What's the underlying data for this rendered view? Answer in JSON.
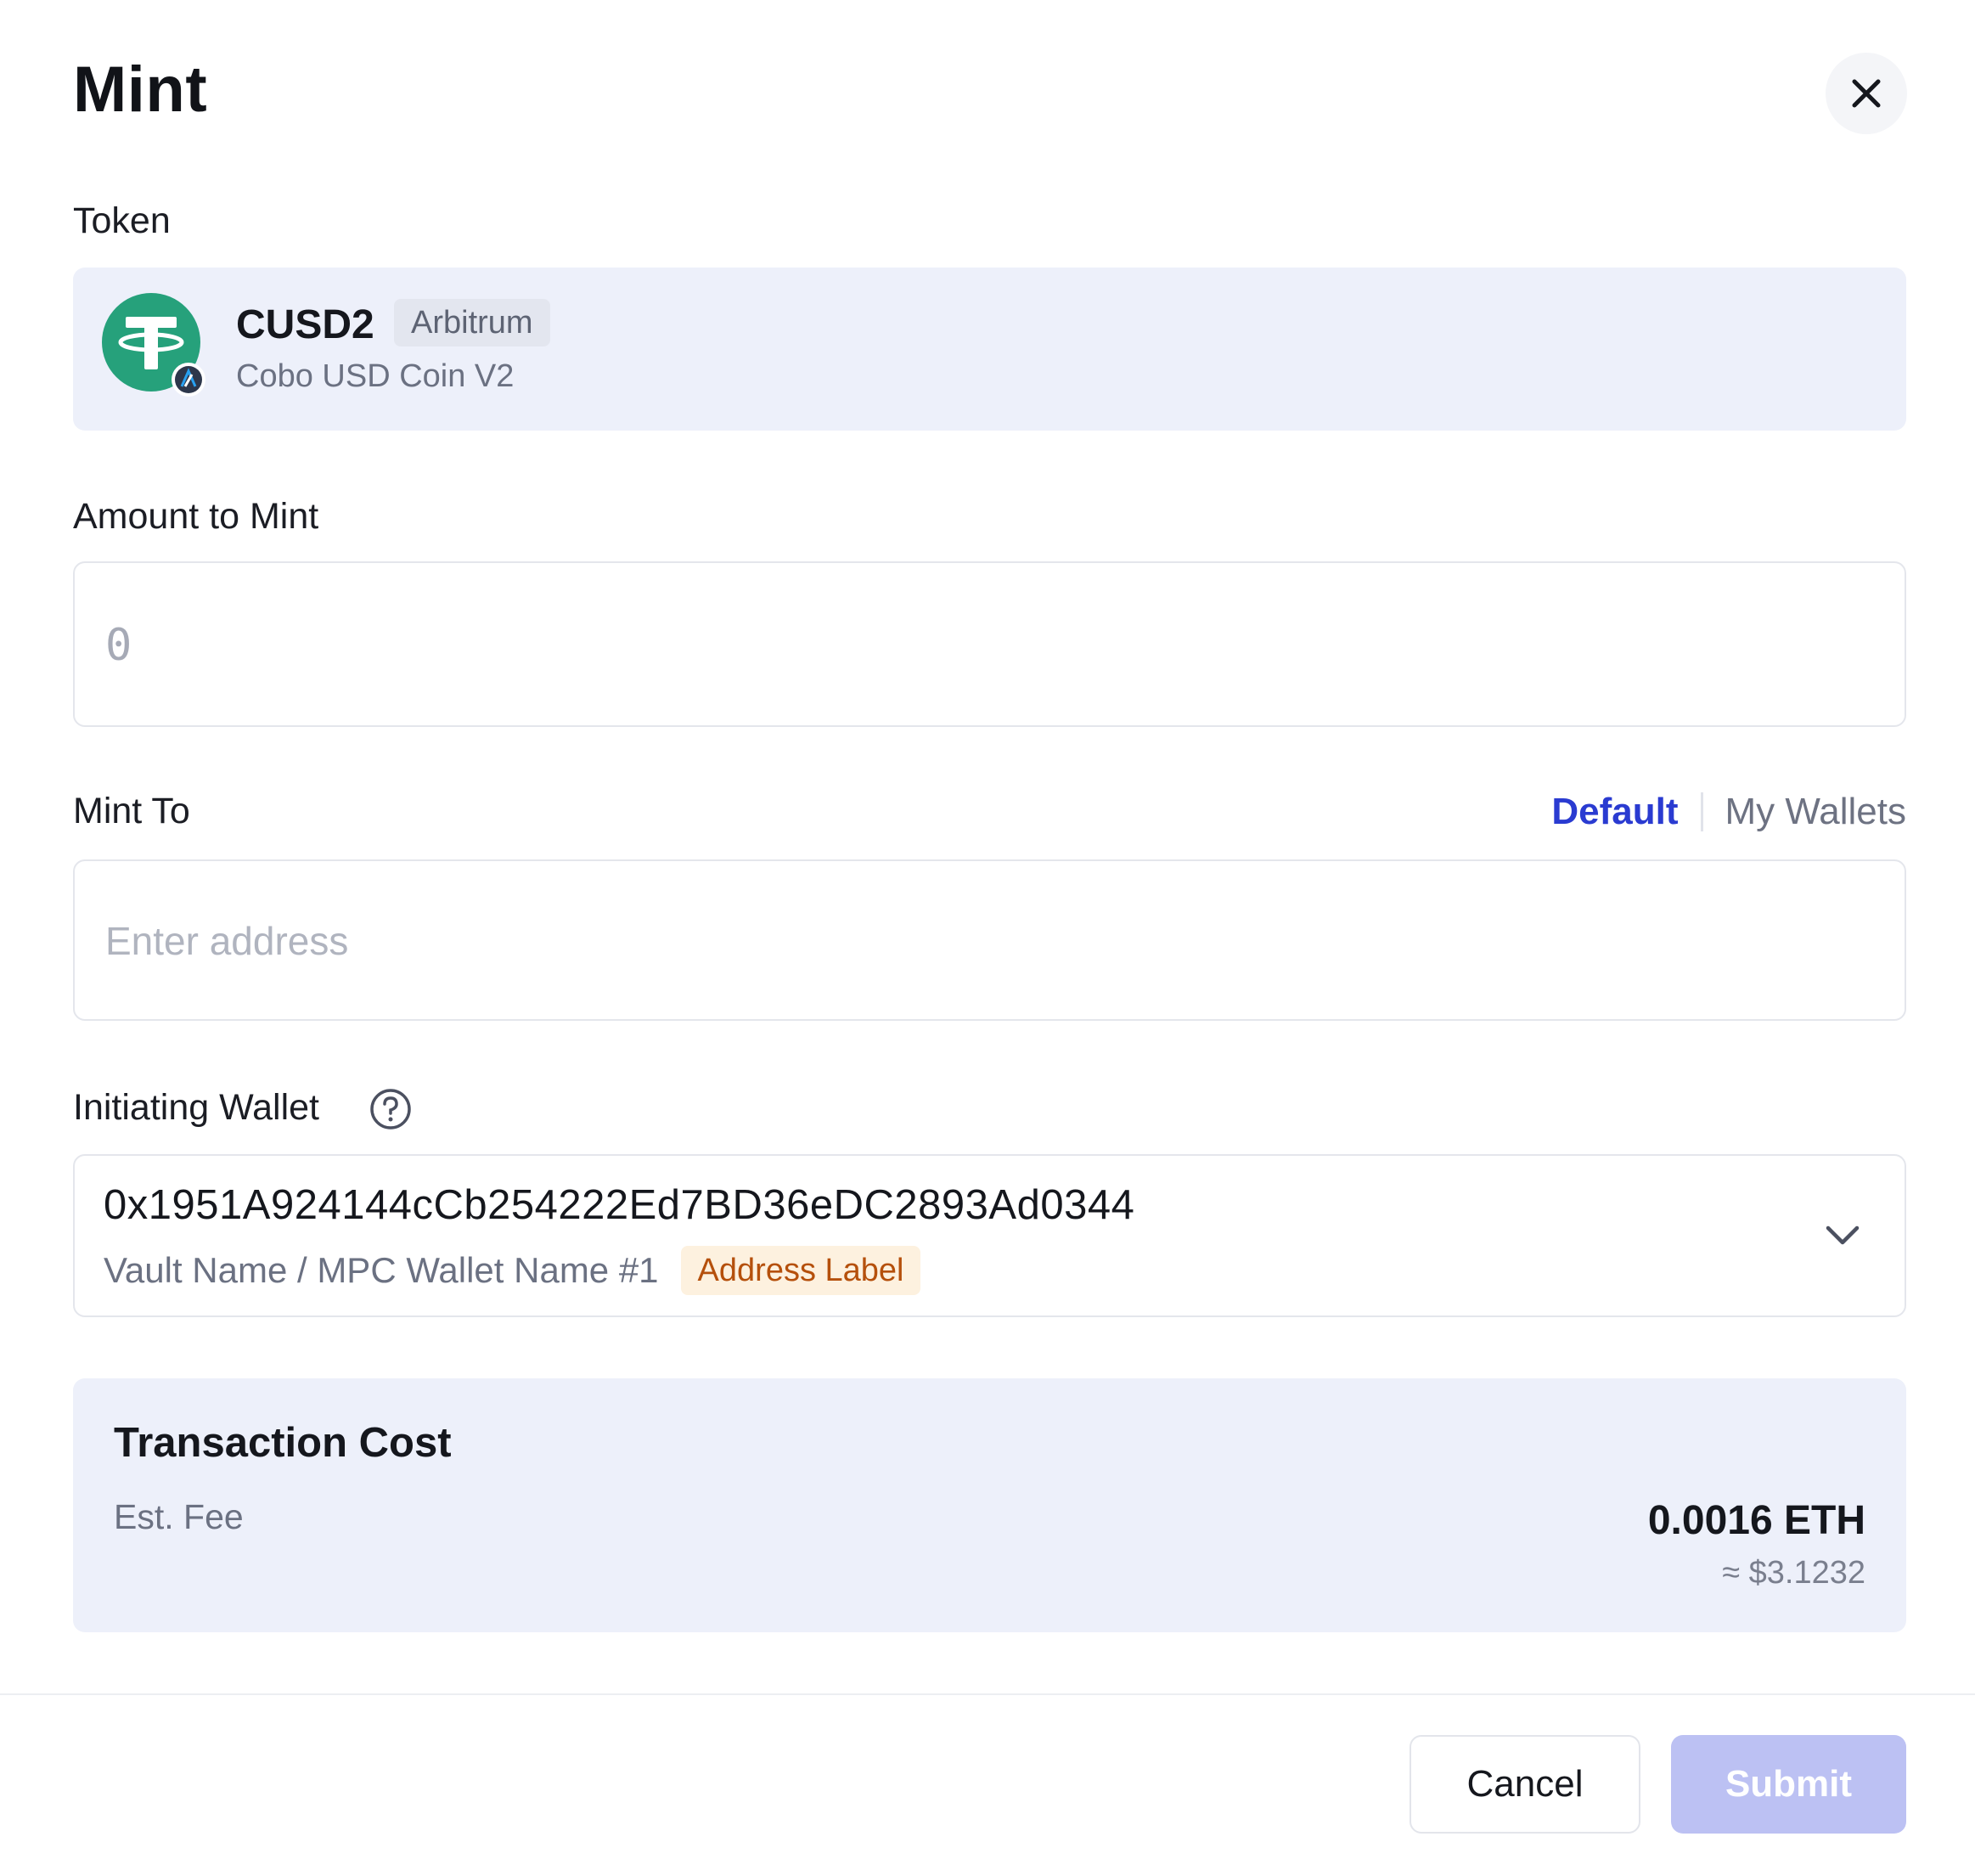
{
  "dialog": {
    "title": "Mint"
  },
  "token": {
    "label": "Token",
    "symbol": "CUSD2",
    "chain": "Arbitrum",
    "name": "Cobo USD Coin V2",
    "logo_icon": "tether-icon",
    "chain_icon": "arbitrum-icon",
    "brand_color": "#26A17B"
  },
  "amount": {
    "label": "Amount to Mint",
    "placeholder": "0",
    "value": ""
  },
  "mint_to": {
    "label": "Mint To",
    "tab_default": "Default",
    "tab_wallets": "My Wallets",
    "active_tab": "Default",
    "placeholder": "Enter address",
    "value": ""
  },
  "initiating_wallet": {
    "label": "Initiating Wallet",
    "address": "0x1951A924144cCb254222Ed7BD36eDC2893Ad0344",
    "wallet_path": "Vault Name / MPC Wallet Name #1",
    "address_label": "Address Label"
  },
  "transaction_cost": {
    "title": "Transaction Cost",
    "fee_label": "Est. Fee",
    "fee_value": "0.0016 ETH",
    "fee_usd": "≈ $3.1232"
  },
  "footer": {
    "cancel_label": "Cancel",
    "submit_label": "Submit"
  },
  "colors": {
    "accent": "#2A3BD1",
    "panel_bg": "#EDF0FA",
    "submit_disabled": "#BCC1F3",
    "label_tag_bg": "#FDF1DF",
    "label_tag_text": "#B5500C"
  }
}
